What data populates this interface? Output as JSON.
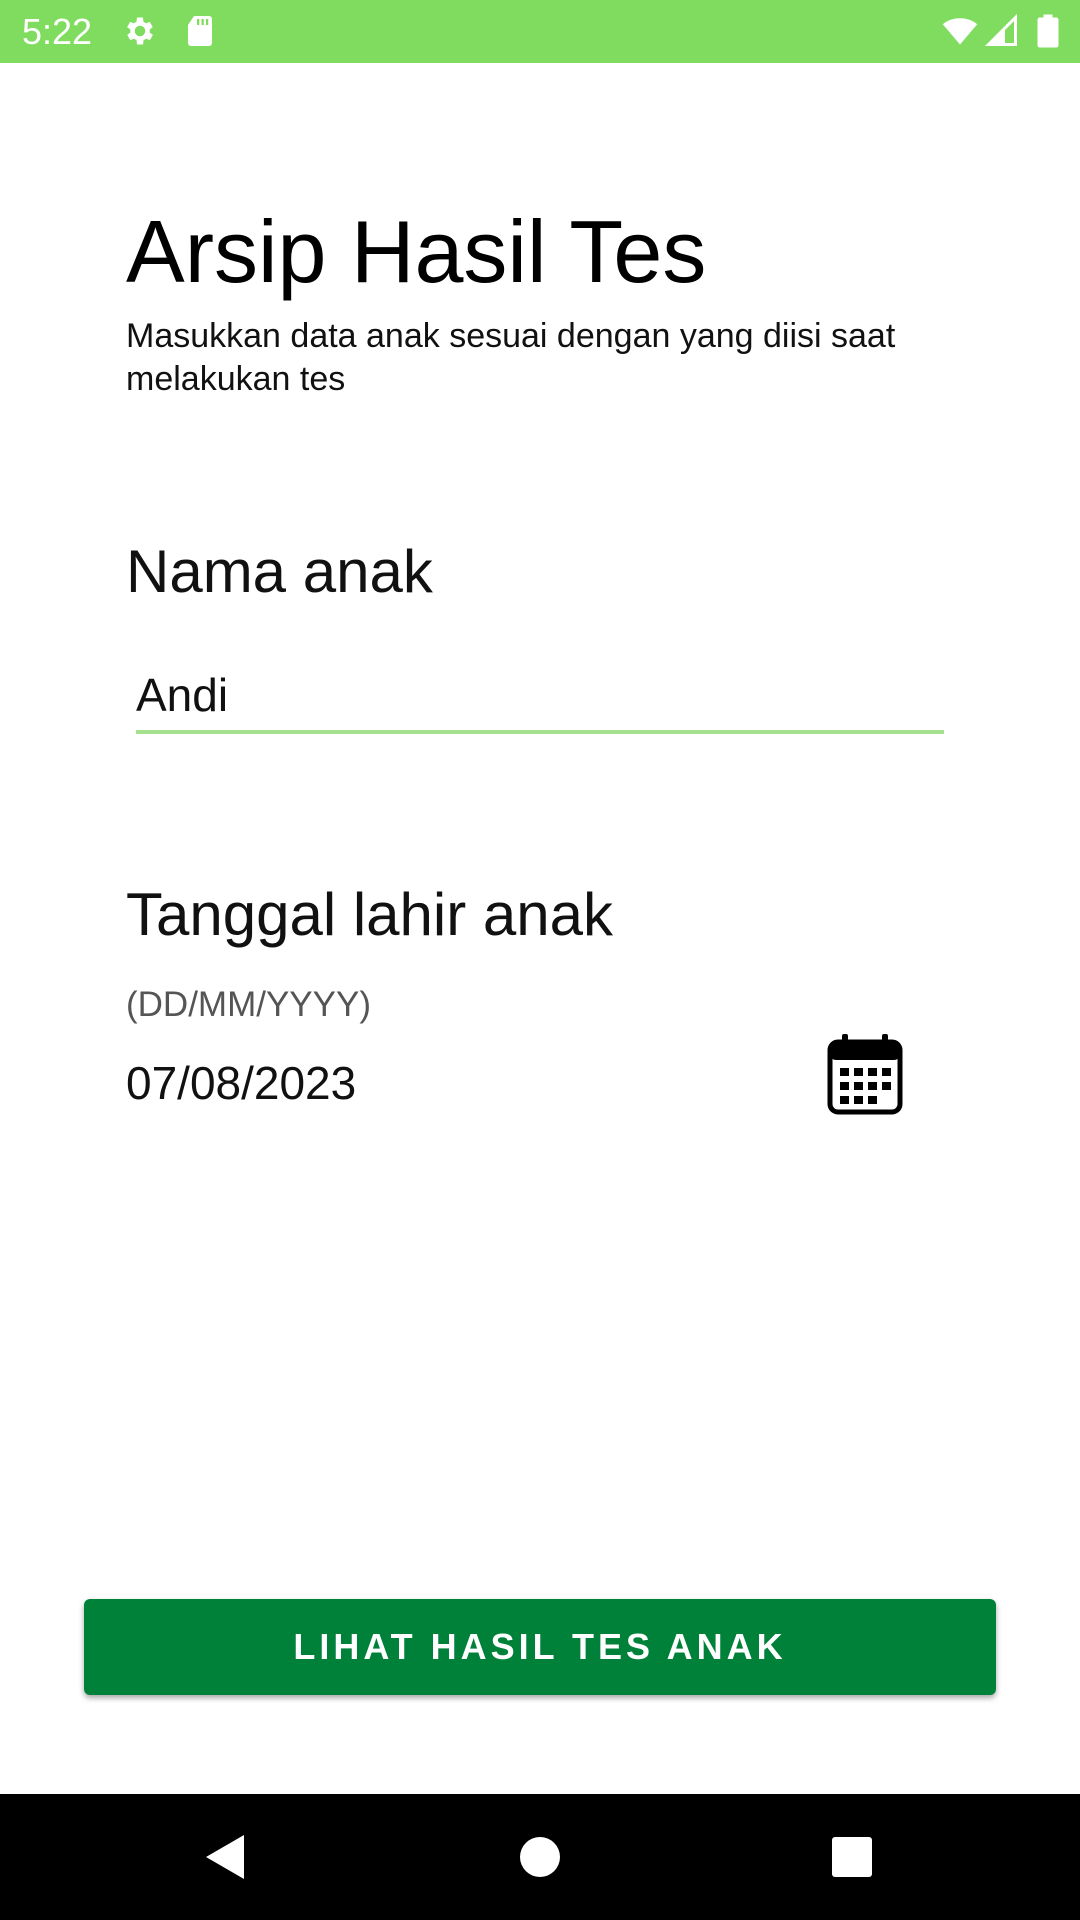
{
  "status_bar": {
    "time": "5:22",
    "background_color": "#7fdc5e",
    "icons": [
      "gear-icon",
      "sd-card-icon",
      "wifi-icon",
      "signal-icon",
      "battery-icon"
    ]
  },
  "header": {
    "title": "Arsip Hasil Tes",
    "subtitle": "Masukkan data anak sesuai dengan yang diisi saat melakukan tes"
  },
  "form": {
    "name_label": "Nama anak",
    "name_value": "Andi",
    "dob_label": "Tanggal lahir anak",
    "dob_hint": "(DD/MM/YYYY)",
    "dob_value": "07/08/2023",
    "calendar_icon": "calendar-icon"
  },
  "actions": {
    "submit_label": "LIHAT HASIL TES ANAK",
    "button_color": "#00813a"
  },
  "nav_bar": {
    "icons": [
      "back-icon",
      "home-icon",
      "recents-icon"
    ]
  },
  "accent_color": "#a6e18f"
}
